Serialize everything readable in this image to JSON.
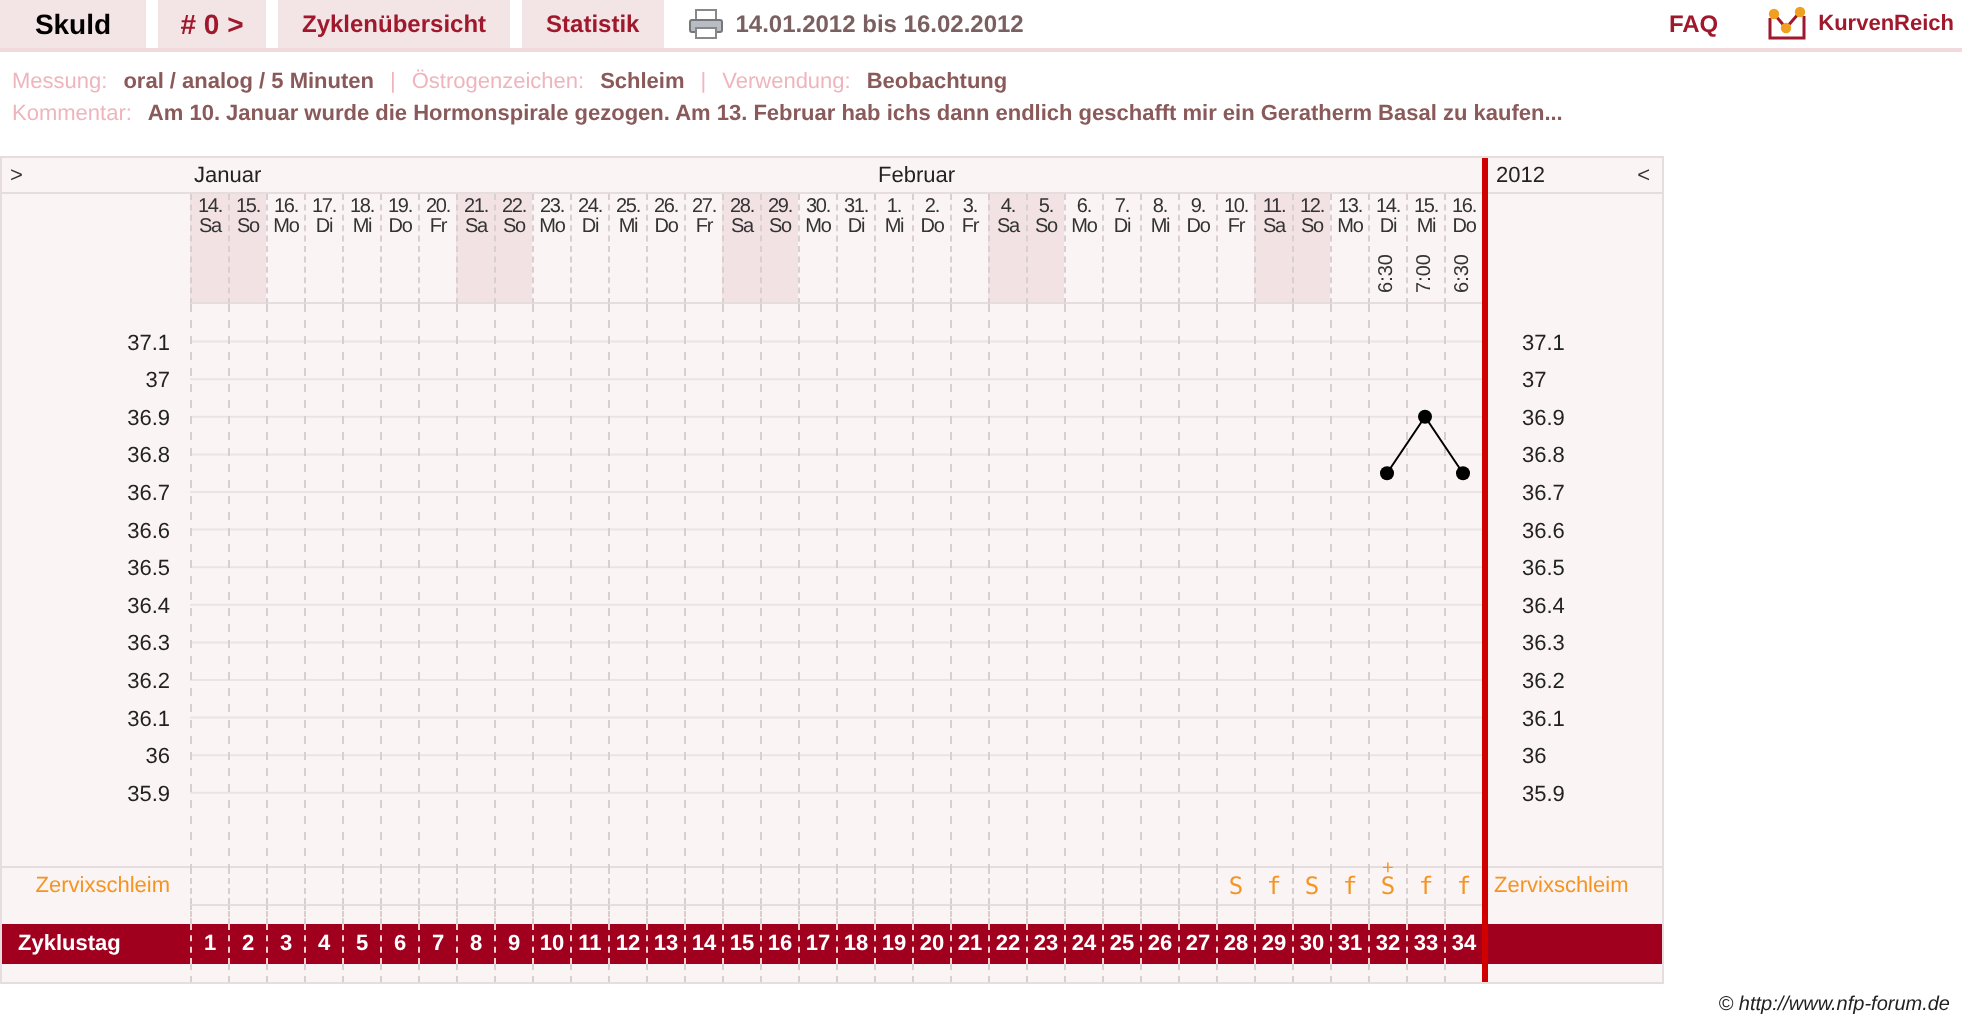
{
  "header": {
    "tabs": [
      {
        "label": "Skuld",
        "kind": "name"
      },
      {
        "label": "# 0 >",
        "kind": "cycle"
      },
      {
        "label": "Zyklenübersicht",
        "kind": "link"
      },
      {
        "label": "Statistik",
        "kind": "link"
      }
    ],
    "date_range": "14.01.2012 bis 16.02.2012",
    "faq": "FAQ",
    "logo": "KurvenReich"
  },
  "info": [
    {
      "label": "Messung:",
      "value": "oral / analog / 5 Minuten"
    },
    {
      "separator": "|",
      "label": "Östrogenzeichen:",
      "value": "Schleim"
    },
    {
      "separator": "|",
      "label": "Verwendung:",
      "value": "Beobachtung"
    }
  ],
  "comment": {
    "label": "Kommentar:",
    "value": "Am 10. Januar wurde die Hormonspirale gezogen. Am 13. Februar hab ichs dann endlich geschafft mir ein Geratherm Basal zu kaufen..."
  },
  "nav": {
    "forward": ">",
    "year": "2012",
    "back": "<"
  },
  "months": [
    {
      "name": "Januar",
      "days": [
        {
          "date": "14.",
          "weekday": "Sa",
          "weekend": true,
          "cycle_day": "1"
        },
        {
          "date": "15.",
          "weekday": "So",
          "weekend": true,
          "cycle_day": "2"
        },
        {
          "date": "16.",
          "weekday": "Mo",
          "weekend": false,
          "cycle_day": "3"
        },
        {
          "date": "17.",
          "weekday": "Di",
          "weekend": false,
          "cycle_day": "4"
        },
        {
          "date": "18.",
          "weekday": "Mi",
          "weekend": false,
          "cycle_day": "5"
        },
        {
          "date": "19.",
          "weekday": "Do",
          "weekend": false,
          "cycle_day": "6"
        },
        {
          "date": "20.",
          "weekday": "Fr",
          "weekend": false,
          "cycle_day": "7"
        },
        {
          "date": "21.",
          "weekday": "Sa",
          "weekend": true,
          "cycle_day": "8"
        },
        {
          "date": "22.",
          "weekday": "So",
          "weekend": true,
          "cycle_day": "9"
        },
        {
          "date": "23.",
          "weekday": "Mo",
          "weekend": false,
          "cycle_day": "10"
        },
        {
          "date": "24.",
          "weekday": "Di",
          "weekend": false,
          "cycle_day": "11"
        },
        {
          "date": "25.",
          "weekday": "Mi",
          "weekend": false,
          "cycle_day": "12"
        },
        {
          "date": "26.",
          "weekday": "Do",
          "weekend": false,
          "cycle_day": "13"
        },
        {
          "date": "27.",
          "weekday": "Fr",
          "weekend": false,
          "cycle_day": "14"
        },
        {
          "date": "28.",
          "weekday": "Sa",
          "weekend": true,
          "cycle_day": "15"
        },
        {
          "date": "29.",
          "weekday": "So",
          "weekend": true,
          "cycle_day": "16"
        },
        {
          "date": "30.",
          "weekday": "Mo",
          "weekend": false,
          "cycle_day": "17"
        },
        {
          "date": "31.",
          "weekday": "Di",
          "weekend": false,
          "cycle_day": "18"
        }
      ]
    },
    {
      "name": "Februar",
      "days": [
        {
          "date": "1.",
          "weekday": "Mi",
          "weekend": false,
          "cycle_day": "19"
        },
        {
          "date": "2.",
          "weekday": "Do",
          "weekend": false,
          "cycle_day": "20"
        },
        {
          "date": "3.",
          "weekday": "Fr",
          "weekend": false,
          "cycle_day": "21"
        },
        {
          "date": "4.",
          "weekday": "Sa",
          "weekend": true,
          "cycle_day": "22"
        },
        {
          "date": "5.",
          "weekday": "So",
          "weekend": true,
          "cycle_day": "23"
        },
        {
          "date": "6.",
          "weekday": "Mo",
          "weekend": false,
          "cycle_day": "24"
        },
        {
          "date": "7.",
          "weekday": "Di",
          "weekend": false,
          "cycle_day": "25"
        },
        {
          "date": "8.",
          "weekday": "Mi",
          "weekend": false,
          "cycle_day": "26"
        },
        {
          "date": "9.",
          "weekday": "Do",
          "weekend": false,
          "cycle_day": "27"
        },
        {
          "date": "10.",
          "weekday": "Fr",
          "weekend": false,
          "cycle_day": "28",
          "mucus": "S"
        },
        {
          "date": "11.",
          "weekday": "Sa",
          "weekend": true,
          "cycle_day": "29",
          "mucus": "f"
        },
        {
          "date": "12.",
          "weekday": "So",
          "weekend": true,
          "cycle_day": "30",
          "mucus": "S"
        },
        {
          "date": "13.",
          "weekday": "Mo",
          "weekend": false,
          "cycle_day": "31",
          "mucus": "f"
        },
        {
          "date": "14.",
          "weekday": "Di",
          "weekend": false,
          "cycle_day": "32",
          "mucus": "S",
          "mucus_mark": "+",
          "time": "6:30"
        },
        {
          "date": "15.",
          "weekday": "Mi",
          "weekend": false,
          "cycle_day": "33",
          "mucus": "f",
          "time": "7:00"
        },
        {
          "date": "16.",
          "weekday": "Do",
          "weekend": false,
          "cycle_day": "34",
          "mucus": "f",
          "time": "6:30"
        }
      ]
    }
  ],
  "temperature": {
    "right_axis_labels": [
      "37.1",
      "37",
      "36.9",
      "36.8",
      "36.7",
      "36.6",
      "36.5",
      "36.4",
      "36.3",
      "36.2",
      "36.1",
      "36",
      "35.9"
    ],
    "chart_data": {
      "type": "line",
      "grid": true,
      "ylim": [
        35.7,
        37.2
      ],
      "yticks": [
        35.9,
        36,
        36.1,
        36.2,
        36.3,
        36.4,
        36.5,
        36.6,
        36.7,
        36.8,
        36.9,
        37,
        37.1
      ],
      "series": [
        {
          "color": "#000000",
          "marker": true,
          "values": [
            null,
            null,
            null,
            null,
            null,
            null,
            null,
            null,
            null,
            null,
            null,
            null,
            null,
            null,
            null,
            null,
            null,
            null,
            null,
            null,
            null,
            null,
            null,
            null,
            null,
            null,
            null,
            null,
            null,
            null,
            null,
            36.75,
            36.9,
            36.75
          ]
        }
      ]
    }
  },
  "mucus_label": "Zervixschleim",
  "mucus_label_right": "Zervixschleim",
  "cycle_label": "Zyklustag",
  "footer": "© http://www.nfp-forum.de"
}
